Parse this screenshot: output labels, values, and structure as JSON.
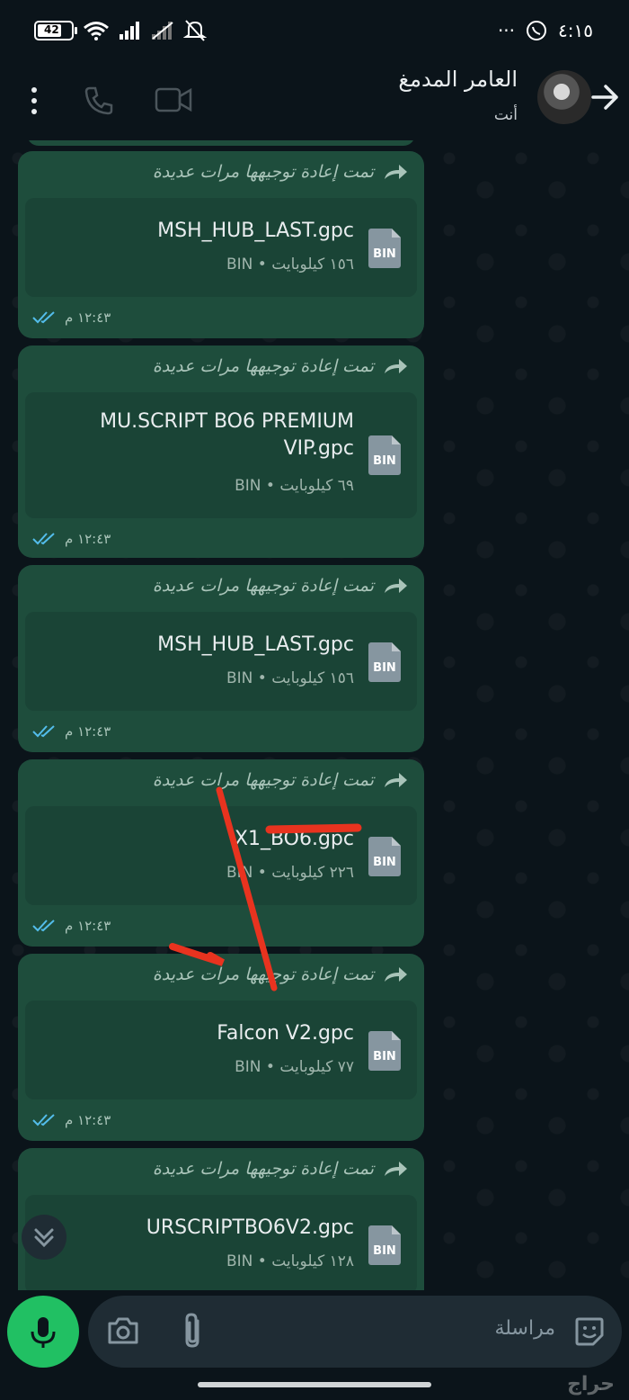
{
  "status_bar": {
    "time": "٤:١٥",
    "battery": "42",
    "dots": "···"
  },
  "header": {
    "contact_name": "العامر المدمغ",
    "subtitle": "أنت"
  },
  "messages": [
    {
      "forwarded": "تمت إعادة توجيهها مرات عديدة",
      "file_name": "MSH_HUB_LAST.gpc",
      "file_meta": "١٥٦ كيلوبايت • BIN",
      "file_type": "BIN",
      "time": "١٢:٤٣ م"
    },
    {
      "forwarded": "تمت إعادة توجيهها مرات عديدة",
      "file_name": "MU.SCRIPT BO6 PREMIUM VIP.gpc",
      "file_meta": "٦٩ كيلوبايت • BIN",
      "file_type": "BIN",
      "time": "١٢:٤٣ م"
    },
    {
      "forwarded": "تمت إعادة توجيهها مرات عديدة",
      "file_name": "MSH_HUB_LAST.gpc",
      "file_meta": "١٥٦ كيلوبايت • BIN",
      "file_type": "BIN",
      "time": "١٢:٤٣ م"
    },
    {
      "forwarded": "تمت إعادة توجيهها مرات عديدة",
      "file_name": "X1_BO6.gpc",
      "file_meta": "٢٢٦ كيلوبايت • BIN",
      "file_type": "BIN",
      "time": "١٢:٤٣ م"
    },
    {
      "forwarded": "تمت إعادة توجيهها مرات عديدة",
      "file_name": "Falcon V2.gpc",
      "file_meta": "٧٧ كيلوبايت • BIN",
      "file_type": "BIN",
      "time": "١٢:٤٣ م"
    },
    {
      "forwarded": "تمت إعادة توجيهها مرات عديدة",
      "file_name": "URSCRIPTBO6V2.gpc",
      "file_meta": "١٢٨ كيلوبايت • BIN",
      "file_type": "BIN",
      "time": ""
    }
  ],
  "input": {
    "placeholder": "مراسلة"
  },
  "watermark": "حراج",
  "colors": {
    "bubble": "#1e4d3c",
    "accent_green": "#21c063",
    "background": "#0b141a",
    "read_ticks": "#53bdeb",
    "annotation_red": "#e8331f"
  }
}
